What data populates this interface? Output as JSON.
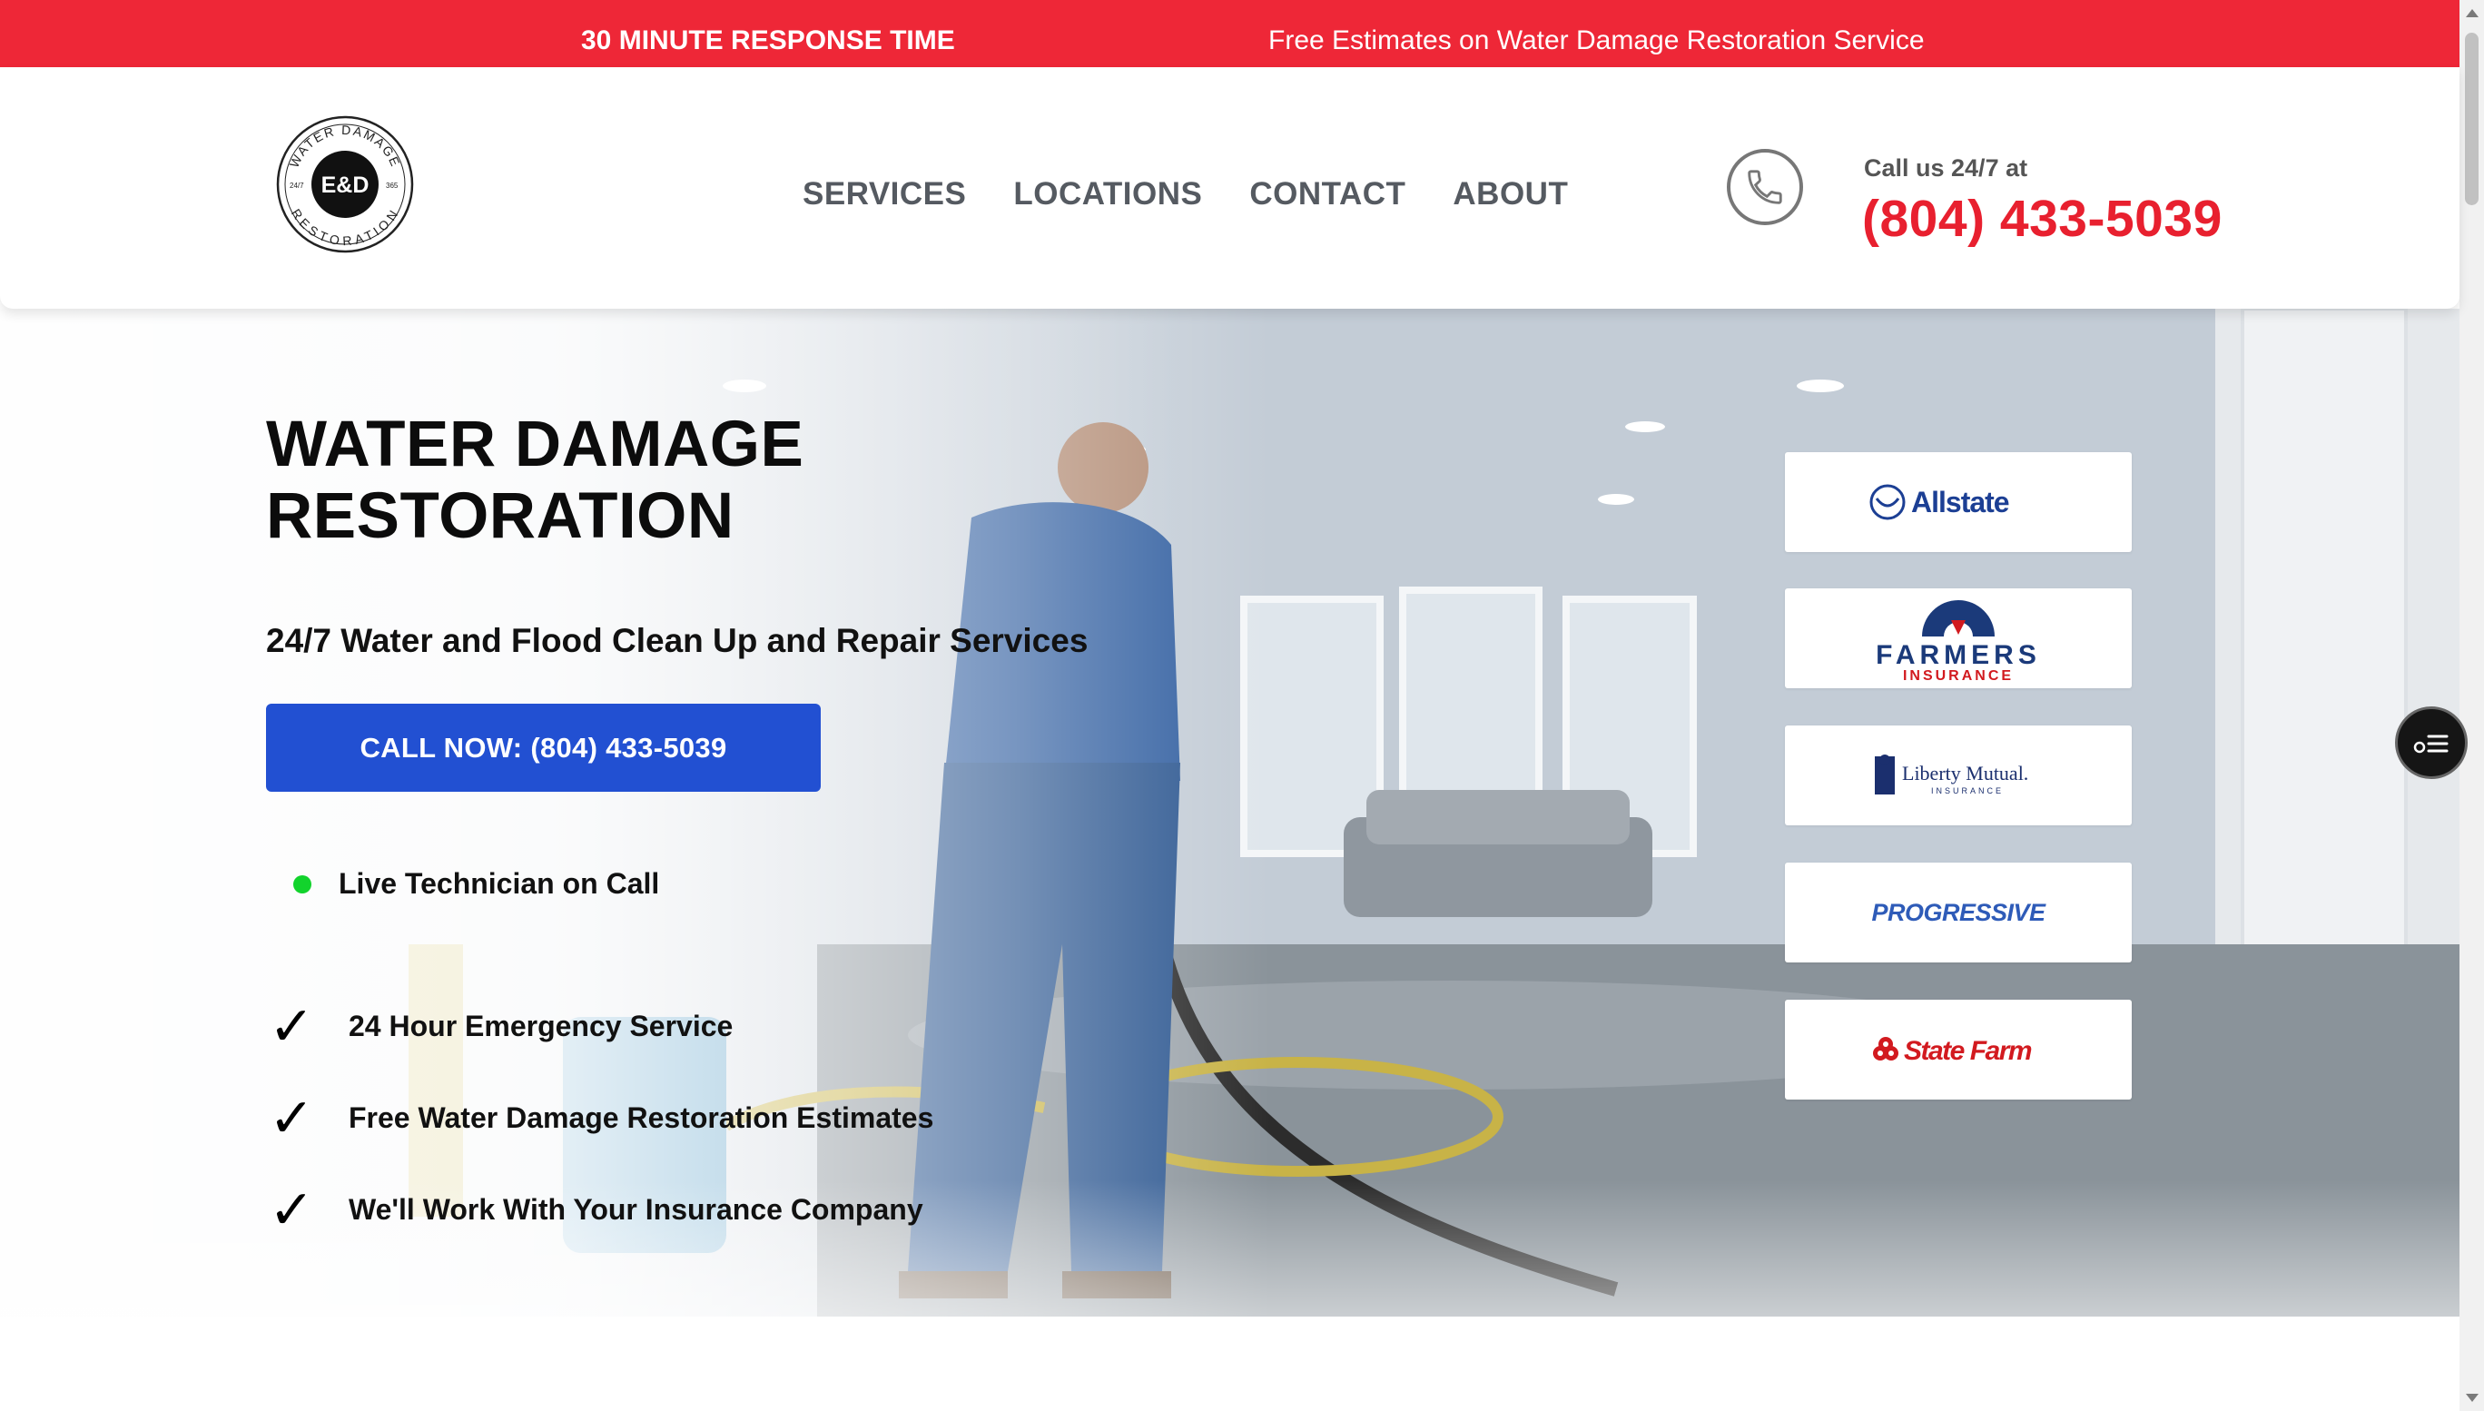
{
  "topbar": {
    "response": "30 MINUTE RESPONSE TIME",
    "estimates": "Free Estimates on Water Damage Restoration Service"
  },
  "logo": {
    "initials": "E&D",
    "top_arc": "WATER DAMAGE",
    "bottom_arc": "RESTORATION",
    "left_small": "24/7",
    "right_small": "365"
  },
  "nav": {
    "items": [
      "SERVICES",
      "LOCATIONS",
      "CONTACT",
      "ABOUT"
    ]
  },
  "contact": {
    "call_label": "Call us 24/7 at",
    "phone": "(804) 433-5039",
    "icon": "phone-icon"
  },
  "hero": {
    "title": "WATER DAMAGE RESTORATION",
    "subtitle": "24/7 Water and Flood Clean Up and Repair Services",
    "cta_label": "CALL NOW: (804) 433-5039",
    "live_label": "Live Technician on Call",
    "checks": [
      "24 Hour Emergency Service",
      "Free Water Damage Restoration Estimates",
      "We'll Work With Your Insurance Company"
    ]
  },
  "insurers": {
    "allstate": "Allstate",
    "farmers_top": "FARMERS",
    "farmers_bottom": "INSURANCE",
    "liberty_top": "Liberty Mutual.",
    "liberty_bottom": "INSURANCE",
    "progressive": "PROGRESSIVE",
    "statefarm": "State Farm"
  },
  "colors": {
    "red": "#ee2737",
    "phone_red": "#e8202f",
    "cta_blue": "#2250d2",
    "live_green": "#12d32c",
    "allstate_blue": "#1c3f94",
    "farmers_navy": "#1b3a7a",
    "progressive_blue": "#2e5bb8",
    "statefarm_red": "#d21a1f"
  }
}
